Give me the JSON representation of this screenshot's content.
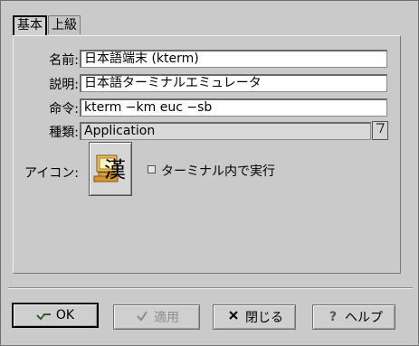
{
  "tabs": [
    "基本",
    "上級"
  ],
  "fields": {
    "name_label": "名前:",
    "name_value": "日本語端末 (kterm)",
    "comment_label": "説明:",
    "comment_value": "日本語ターミナルエミュレータ",
    "command_label": "命令:",
    "command_value": "kterm −km euc −sb",
    "type_label": "種類:",
    "type_value": "Application",
    "icon_label": "アイコン:",
    "icon_glyph": "漢",
    "terminal_label": "ターミナル内で実行"
  },
  "buttons": {
    "ok": "OK",
    "apply": "適用",
    "close": "閉じる",
    "help": "ヘルプ"
  },
  "icons": {
    "ok": "ok-check-icon",
    "apply": "apply-check-icon",
    "close": "close-x-icon",
    "help": "help-question-icon",
    "dropdown": "dropdown-arrow-icon"
  }
}
